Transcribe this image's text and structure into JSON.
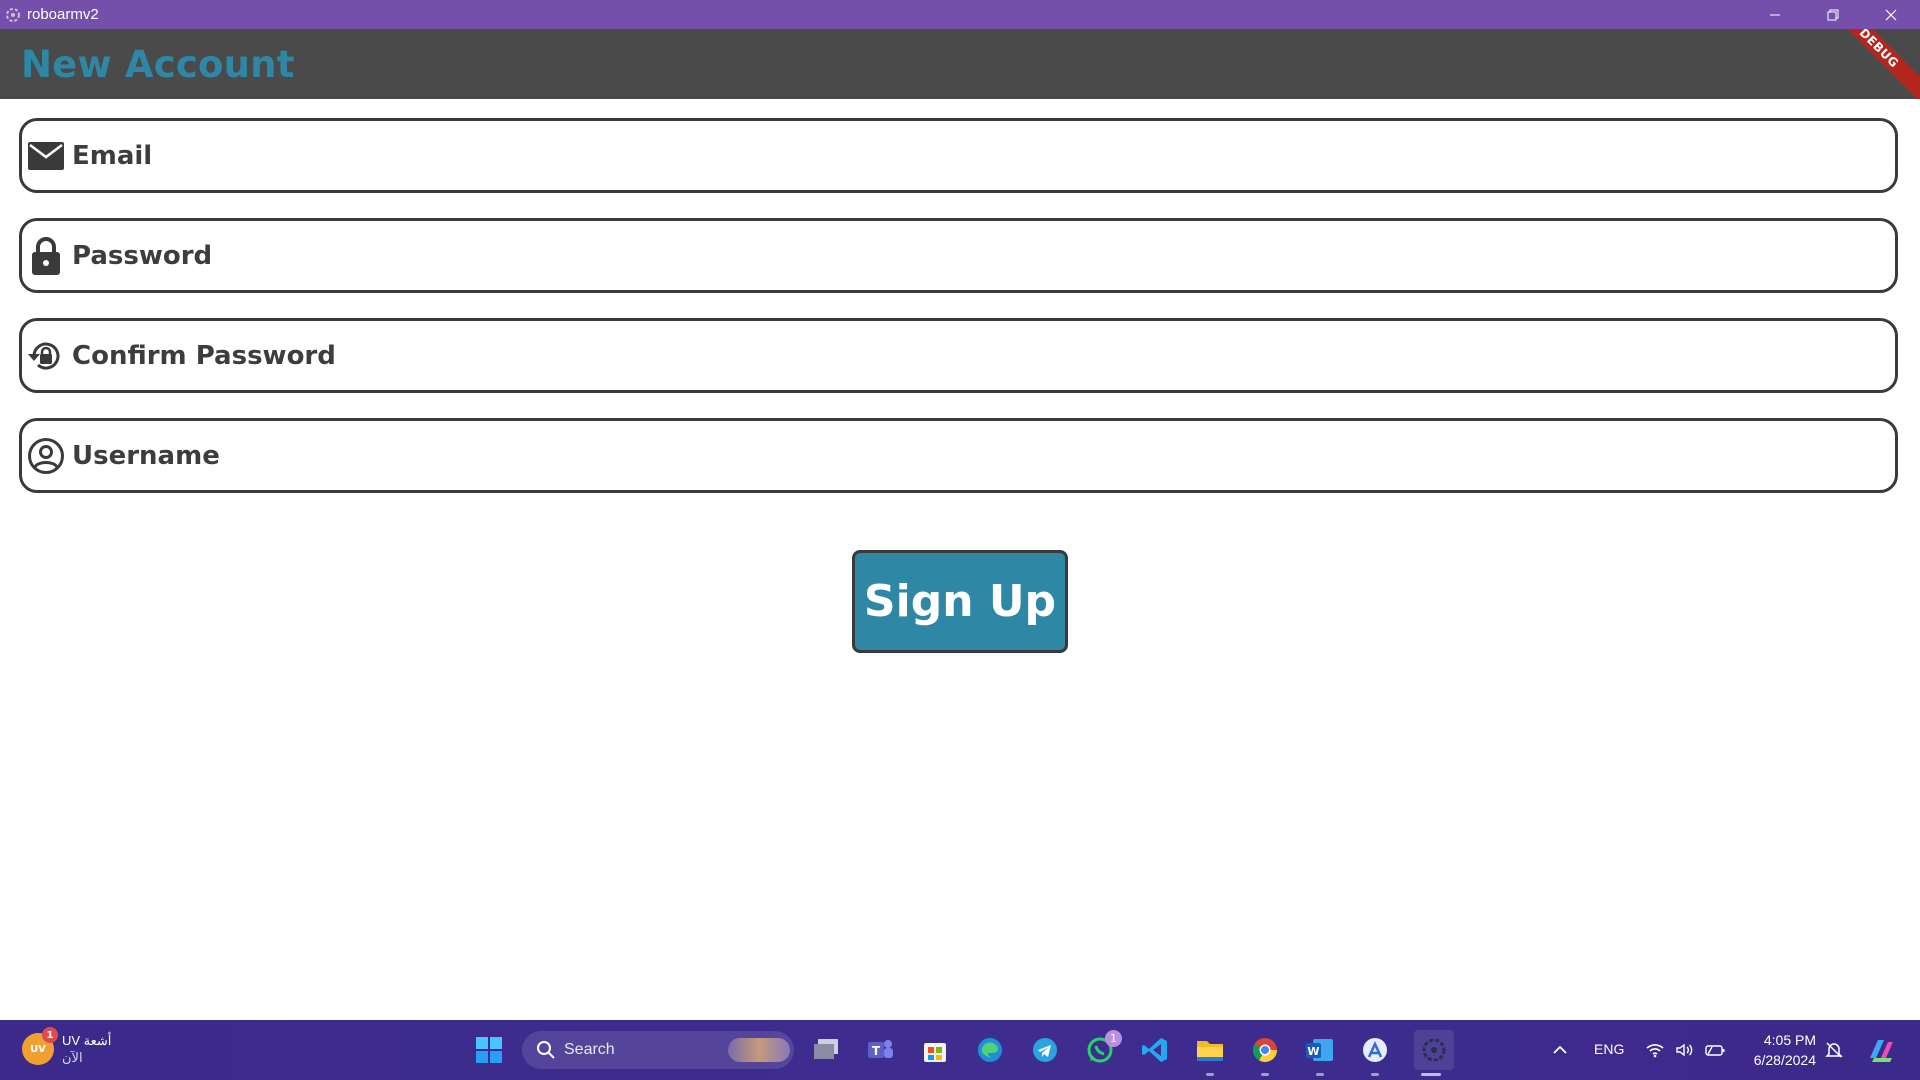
{
  "window": {
    "title": "roboarmv2"
  },
  "appbar": {
    "title": "New Account",
    "debug_banner": "DEBUG"
  },
  "form": {
    "email_label": "Email",
    "password_label": "Password",
    "confirm_password_label": "Confirm Password",
    "username_label": "Username",
    "signup_label": "Sign Up"
  },
  "taskbar": {
    "weather_title": "UV أشعة",
    "weather_subtitle": "الآن",
    "weather_badge": "1",
    "weather_icon_text": "UV",
    "search_label": "Search",
    "whatsapp_badge": "1",
    "language": "ENG",
    "time": "4:05 PM",
    "date": "6/28/2024"
  },
  "colors": {
    "titlebar": "#7550ab",
    "appbar": "#4a4a4a",
    "accent": "#2e87a5",
    "taskbar": "#3b2a8a"
  }
}
